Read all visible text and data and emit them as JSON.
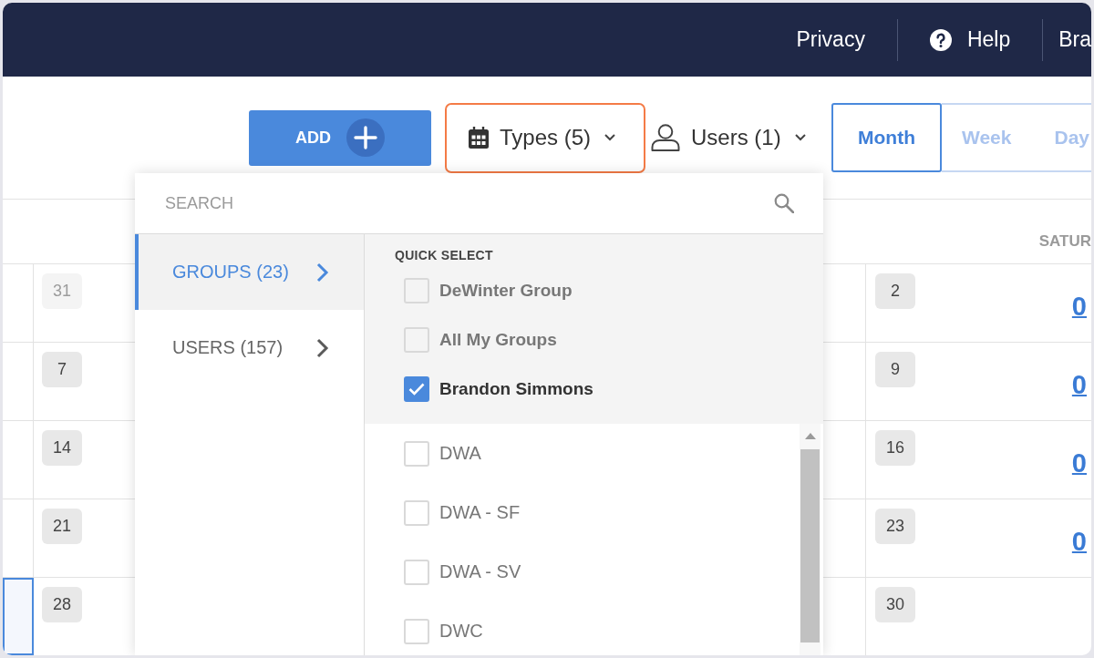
{
  "top_nav": {
    "links": [
      {
        "kind": "link",
        "label": "Privacy"
      },
      {
        "kind": "help",
        "label": "Help"
      },
      {
        "kind": "link",
        "label": "Bra"
      }
    ]
  },
  "toolbar": {
    "add_button": {
      "label": "ADD"
    },
    "filters": [
      {
        "kind": "types",
        "label": "Types (5)",
        "highlighted": true
      },
      {
        "kind": "users",
        "label": "Users (1)",
        "highlighted": false
      }
    ],
    "views": [
      {
        "label": "Month",
        "selected": true
      },
      {
        "label": "Week",
        "selected": false
      },
      {
        "label": "Day",
        "selected": false
      }
    ]
  },
  "calendar": {
    "column_header": "SATUR",
    "weeks": [
      {
        "stub_selected": false,
        "left_day": {
          "label": "31",
          "muted": true
        },
        "right_day": {
          "label": "2",
          "muted": false
        },
        "count": "0"
      },
      {
        "stub_selected": false,
        "left_day": {
          "label": "7",
          "muted": false
        },
        "right_day": {
          "label": "9",
          "muted": false
        },
        "count": "0"
      },
      {
        "stub_selected": false,
        "left_day": {
          "label": "14",
          "muted": false
        },
        "right_day": {
          "label": "16",
          "muted": false
        },
        "count": "0"
      },
      {
        "stub_selected": false,
        "left_day": {
          "label": "21",
          "muted": false
        },
        "right_day": {
          "label": "23",
          "muted": false
        },
        "count": "0"
      },
      {
        "stub_selected": true,
        "left_day": {
          "label": "28",
          "muted": false
        },
        "right_day": {
          "label": "30",
          "muted": false
        }
      }
    ]
  },
  "dropdown": {
    "search": {
      "placeholder": "SEARCH"
    },
    "categories": [
      {
        "label": "GROUPS (23)",
        "selected": true
      },
      {
        "label": "USERS (157)",
        "selected": false
      }
    ],
    "quick_select": {
      "title": "QUICK SELECT",
      "items": [
        {
          "label": "DeWinter Group",
          "checked": false
        },
        {
          "label": "All My Groups",
          "checked": false
        },
        {
          "label": "Brandon Simmons",
          "checked": true
        }
      ]
    },
    "items": [
      {
        "label": "DWA",
        "checked": false
      },
      {
        "label": "DWA - SF",
        "checked": false
      },
      {
        "label": "DWA - SV",
        "checked": false
      },
      {
        "label": "DWC",
        "checked": false
      }
    ]
  }
}
